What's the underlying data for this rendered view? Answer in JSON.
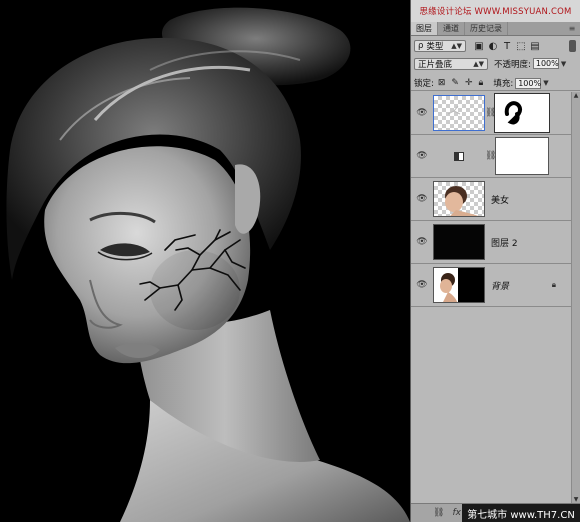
{
  "watermark_top": "思缘设计论坛 WWW.MISSYUAN.COM",
  "watermark_bottom": "第七城市 www.TH7.CN",
  "tabs": [
    {
      "label": "图层",
      "active": true
    },
    {
      "label": "通道",
      "active": false
    },
    {
      "label": "历史记录",
      "active": false
    }
  ],
  "filter": {
    "label": "类型",
    "prefix": "ρ"
  },
  "blend_mode": "正片叠底",
  "opacity": {
    "label": "不透明度:",
    "value": "100%"
  },
  "lock_label": "锁定:",
  "fill": {
    "label": "填充:",
    "value": "100%"
  },
  "layers": [
    {
      "name": "",
      "kind": "masked-selected"
    },
    {
      "name": "",
      "kind": "adjustment"
    },
    {
      "name": "美女",
      "kind": "portrait"
    },
    {
      "name": "图层 2",
      "kind": "black"
    },
    {
      "name": "背景",
      "kind": "background",
      "locked": true
    }
  ],
  "colors": {
    "panel_bg": "#b9b9b9",
    "canvas_bg": "#000000",
    "watermark_red": "#b0151a"
  }
}
